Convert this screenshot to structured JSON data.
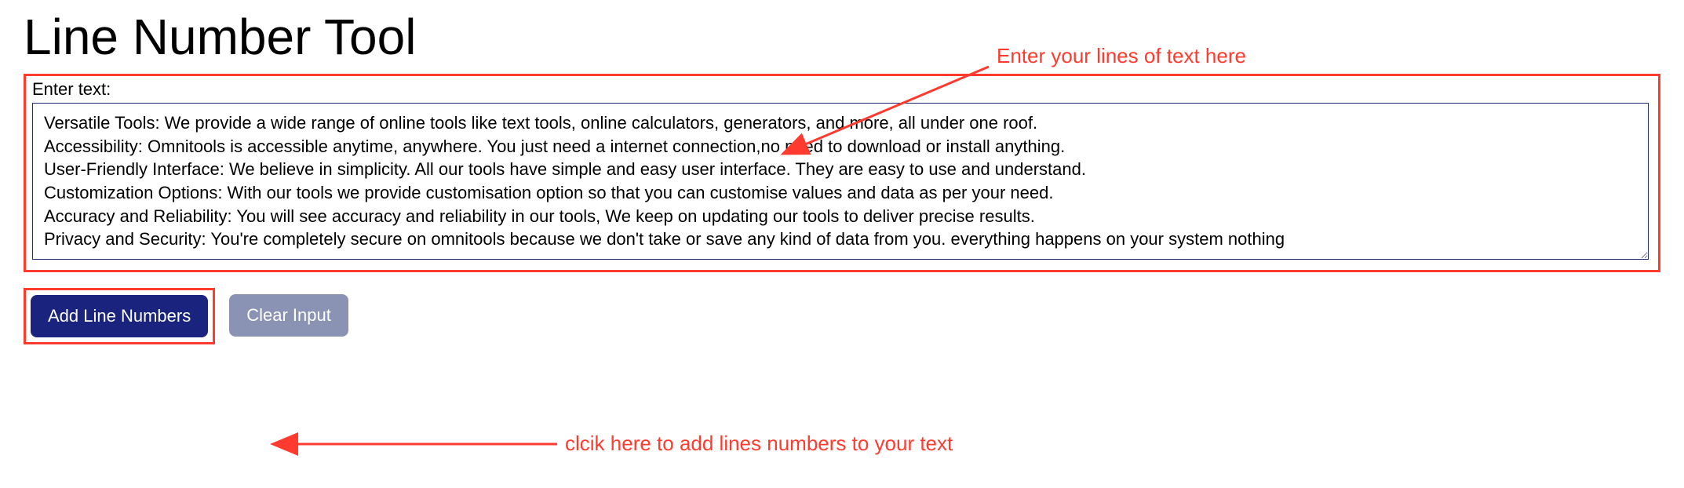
{
  "page": {
    "title": "Line Number Tool"
  },
  "input": {
    "label": "Enter text:",
    "value": "Versatile Tools: We provide a wide range of online tools like text tools, online calculators, generators, and more, all under one roof.\nAccessibility: Omnitools is accessible anytime, anywhere. You just need a internet connection,no need to download or install anything.\nUser-Friendly Interface: We believe in simplicity. All our tools have simple and easy user interface. They are easy to use and understand.\nCustomization Options: With our tools we provide customisation option so that you can customise values and data as per your need.\nAccuracy and Reliability: You will see accuracy and reliability in our tools, We keep on updating our tools to deliver precise results.\nPrivacy and Security: You're completely secure on omnitools because we don't take or save any kind of data from you. everything happens on your system nothing"
  },
  "buttons": {
    "add": "Add Line Numbers",
    "clear": "Clear Input"
  },
  "annotations": {
    "enter": "Enter your lines of text here",
    "click": "clcik here to add lines numbers to your text"
  },
  "colors": {
    "highlight": "#ff3b30",
    "primary_button": "#1a237e",
    "secondary_button": "#8a93b3"
  }
}
